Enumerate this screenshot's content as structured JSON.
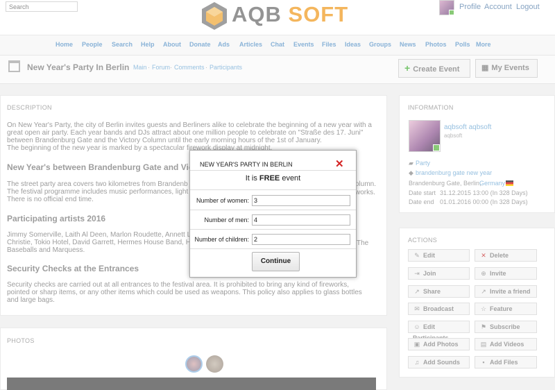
{
  "search": {
    "placeholder": "Search"
  },
  "logo": {
    "part1": "AQB",
    "part2": "SOFT"
  },
  "userbar": {
    "profile": "Profile",
    "account": "Account",
    "logout": "Logout"
  },
  "nav": [
    "Home",
    "People",
    "Search",
    "Help",
    "About",
    "Donate",
    "Ads",
    "Articles",
    "Chat",
    "Events",
    "Files",
    "Ideas",
    "Groups",
    "News",
    "Photos",
    "Polls",
    "More"
  ],
  "page": {
    "title": "New Year's Party In Berlin",
    "breadcrumbs": [
      "Main",
      "Forum",
      "Comments",
      "Participants"
    ],
    "create_event": "Create Event",
    "my_events": "My Events"
  },
  "description": {
    "header": "DESCRIPTION",
    "p1": [
      "On New Year's Party, the city of Berlin invites guests and Berliners alike to celebrate the beginning of a new year with a",
      "great open air party. Each year bands and DJs attract about one million people to celebrate on \"Straße des 17. Juni\"",
      "between Brandenburg Gate and the Victory Column until the early morning hours of the 1st of January.",
      "The beginning of the new year is marked by a spectacular firework display at midnight."
    ],
    "h1": "New Year's between Brandenburg Gate and Victo",
    "p2": [
      "The street party area covers two kilometres from Brandenb",
      "The festival programme includes music performances, light",
      "There is no official end time."
    ],
    "p2_right": [
      "olumn.",
      "works."
    ],
    "h2": "Participating artists 2016",
    "p3": [
      "Jimmy Somerville, Laith Al Deen, Marlon Roudette, Annett L",
      "Christie, Tokio Hotel, David Garrett, Hermes House Band, H",
      "Baseballs and Marquess."
    ],
    "p3_right": "The",
    "h3": "Security Checks at the Entrances",
    "p4": [
      "Security checks are carried out at all entrances to the festival area. It is prohibited to bring any kind of fireworks,",
      "pointed or sharp items, or any other items which could be used as weapons. This policy also applies to glass bottles",
      "and large bags."
    ]
  },
  "photos": {
    "header": "PHOTOS"
  },
  "info": {
    "header": "INFORMATION",
    "user_name": "aqbsoft aqbsoft",
    "user_handle": "aqbsoft",
    "category": "Party",
    "tags": "brandenburg gate new year",
    "location_city": "Brandenburg Gate, Berlin,",
    "location_country": "Germany",
    "date_start_label": "Date start",
    "date_start": "31.12.2015 13:00 (In 328 Days)",
    "date_end_label": "Date end",
    "date_end": "01.01.2016 00:00 (In 328 Days)"
  },
  "actions": {
    "header": "ACTIONS",
    "buttons": [
      {
        "label": "Edit",
        "icon": "edit-icon"
      },
      {
        "label": "Delete",
        "icon": "delete-icon"
      },
      {
        "label": "Join",
        "icon": "join-icon"
      },
      {
        "label": "Invite",
        "icon": "invite-icon"
      },
      {
        "label": "Share",
        "icon": "share-icon"
      },
      {
        "label": "Invite a friend",
        "icon": "invite-friend-icon"
      },
      {
        "label": "Broadcast",
        "icon": "broadcast-icon"
      },
      {
        "label": "Feature",
        "icon": "star-icon"
      },
      {
        "label": "Edit Participants",
        "icon": "users-icon"
      },
      {
        "label": "Subscribe",
        "icon": "subscribe-icon"
      },
      {
        "label": "Add Photos",
        "icon": "photo-icon"
      },
      {
        "label": "Add Videos",
        "icon": "video-icon"
      },
      {
        "label": "Add Sounds",
        "icon": "music-icon"
      },
      {
        "label": "Add Files",
        "icon": "file-icon"
      }
    ]
  },
  "modal": {
    "title": "NEW YEAR'S PARTY IN BERLIN",
    "sub_pre": "It is ",
    "sub_bold": "FREE",
    "sub_post": " event",
    "women_label": "Number of women:",
    "women_value": "3",
    "men_label": "Number of men:",
    "men_value": "4",
    "children_label": "Number of children:",
    "children_value": "2",
    "continue": "Continue"
  },
  "colors": {
    "accent": "#6fa2cf",
    "brand_orange": "#f2a63a",
    "close_red": "#d42424"
  }
}
